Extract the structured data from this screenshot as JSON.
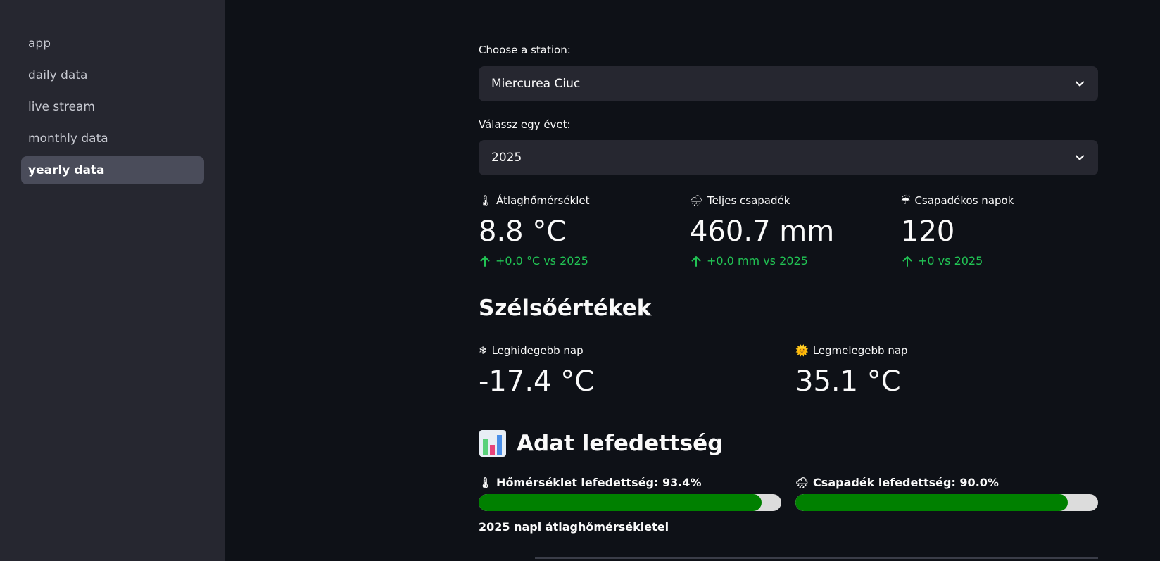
{
  "sidebar": {
    "items": [
      {
        "label": "app",
        "active": false
      },
      {
        "label": "daily data",
        "active": false
      },
      {
        "label": "live stream",
        "active": false
      },
      {
        "label": "monthly data",
        "active": false
      },
      {
        "label": "yearly data",
        "active": true
      }
    ]
  },
  "station_select": {
    "label": "Choose a station:",
    "value": "Miercurea Ciuc"
  },
  "year_select": {
    "label": "Válassz egy évet:",
    "value": "2025"
  },
  "metrics": [
    {
      "icon": "thermometer-icon",
      "label": "Átlaghőmérséklet",
      "value": "8.8 °C",
      "delta": "+0.0 °C vs 2025"
    },
    {
      "icon": "rain-cloud-icon",
      "label": "Teljes csapadék",
      "value": "460.7 mm",
      "delta": "+0.0 mm vs 2025"
    },
    {
      "icon": "umbrella-icon",
      "label": "Csapadékos napok",
      "value": "120",
      "delta": "+0 vs 2025"
    }
  ],
  "extremes": {
    "heading": "Szélsőértékek",
    "coldest": {
      "icon": "snowflake-icon",
      "label": "Leghidegebb nap",
      "value": "-17.4 °C"
    },
    "warmest": {
      "icon": "sun-icon",
      "label": "Legmelegebb nap",
      "value": "35.1 °C"
    }
  },
  "coverage": {
    "icon": "bar-chart-icon",
    "heading": "Adat lefedettség",
    "temperature": {
      "icon": "thermometer-icon",
      "label": "Hőmérséklet lefedettség: 93.4%",
      "fraction": 0.934
    },
    "precipitation": {
      "icon": "rain-cloud-icon",
      "label": "Csapadék lefedettség: 90.0%",
      "fraction": 0.9
    }
  },
  "chart_caption": "2025 napi átlaghőmérsékletei",
  "colors": {
    "background": "#0e1117",
    "sidebar": "#262730",
    "positive_delta": "#21c354",
    "progress_fill": "#008000"
  }
}
